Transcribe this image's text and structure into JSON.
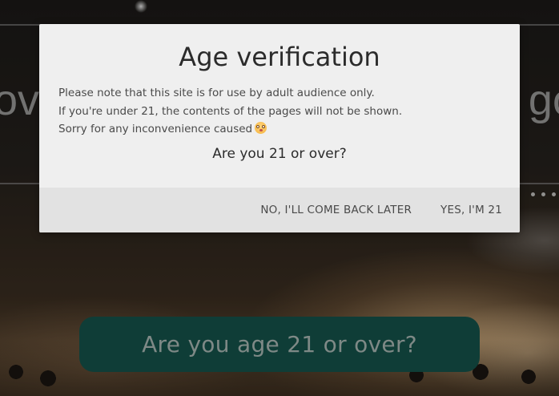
{
  "background": {
    "left_word": "ov",
    "right_word": "go",
    "cta_label": "Are you age 21 or over?"
  },
  "modal": {
    "title": "Age verification",
    "body_lines": [
      "Please note that this site is for use by adult audience only.",
      "If you're under 21, the contents of the pages will not be shown.",
      "Sorry for any inconvenience caused"
    ],
    "emoji_icon": "flushed-face-icon",
    "question": "Are you 21 or over?",
    "buttons": {
      "decline_label": "NO, I'LL COME BACK LATER",
      "accept_label": "YES, I'M 21"
    }
  },
  "colors": {
    "cta_background": "#14524a",
    "modal_background": "#efefef",
    "footer_background": "#e2e2e2"
  }
}
